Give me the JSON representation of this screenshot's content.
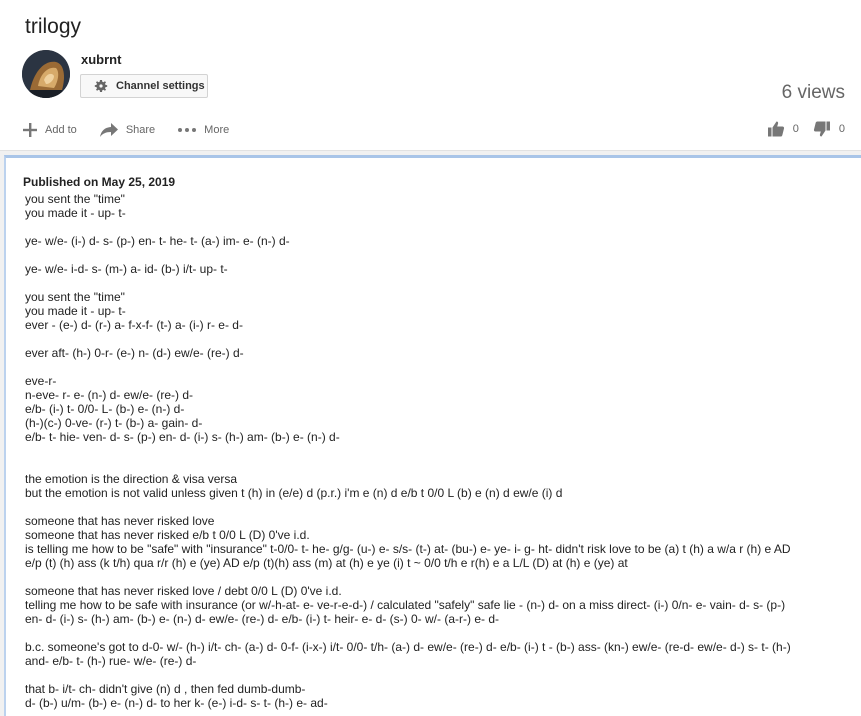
{
  "video": {
    "title": "trilogy",
    "views": "6 views",
    "likes": "0",
    "dislikes": "0"
  },
  "channel": {
    "name": "xubrnt",
    "settings_label": "Channel settings"
  },
  "actions": {
    "add_to": "Add to",
    "share": "Share",
    "more": "More"
  },
  "icons": {
    "add": "plus-icon",
    "share": "share-arrow-icon",
    "more": "more-dots-icon",
    "like": "thumbs-up-icon",
    "dislike": "thumbs-down-icon",
    "settings": "gear-icon"
  },
  "colors": {
    "accent_border": "#a9c5e8",
    "text": "#222222",
    "muted": "#666666"
  },
  "description": {
    "published": "Published on May 25, 2019",
    "body": "you sent the \"time\"\nyou made it - up- t-\n\nye- w/e- (i-) d- s- (p-) en- t- he- t- (a-) im- e- (n-) d-\n\nye- w/e- i-d- s- (m-) a- id- (b-) i/t- up- t-\n\nyou sent the \"time\"\nyou made it - up- t-\never - (e-) d- (r-) a- f-x-f- (t-) a- (i-) r- e- d-\n\never aft- (h-) 0-r- (e-) n- (d-) ew/e- (re-) d-\n\neve-r-\nn-eve- r- e- (n-) d- ew/e- (re-) d-\ne/b- (i-) t- 0/0- L- (b-) e- (n-) d-\n(h-)(c-) 0-ve- (r-) t- (b-) a- gain- d-\ne/b- t- hie- ven- d- s- (p-) en- d- (i-) s- (h-) am- (b-) e- (n-) d-\n\n\nthe emotion is the direction & visa versa\nbut the emotion is not valid unless given t (h) in (e/e) d (p.r.) i'm e (n) d e/b t 0/0 L (b) e (n) d ew/e (i) d\n\nsomeone that has never risked love\nsomeone that has never risked e/b t 0/0 L (D) 0've i.d.\nis telling me how to be \"safe\" with \"insurance\" t-0/0- t- he- g/g- (u-) e- s/s- (t-) at- (bu-) e- ye- i- g- ht- didn't risk love to be (a) t (h) a w/a r (h) e AD\ne/p (t) (h) ass (k t/h) qua r/r (h) e (ye) AD e/p (t)(h) ass (m) at (h) e ye (i) t ~ 0/0 t/h e r(h) e a L/L (D) at (h) e (ye) at\n\nsomeone that has never risked love / debt 0/0 L (D) 0've i.d.\ntelling me how to be safe with insurance (or w/-h-at- e- ve-r-e-d-) / calculated \"safely\" safe lie - (n-) d- on a miss direct- (i-) 0/n- e- vain- d- s- (p-)\nen- d- (i-) s- (h-) am- (b-) e- (n-) d- ew/e- (re-) d- e/b- (i-) t- heir- e- d- (s-) 0- w/- (a-r-) e- d-\n\nb.c. someone's got to d-0- w/- (h-) i/t- ch- (a-) d- 0-f- (i-x-) i/t- 0/0- t/h- (a-) d- ew/e- (re-) d- e/b- (i-) t - (b-) ass- (kn-) ew/e- (re-d- ew/e- d-) s- t- (h-)\nand- e/b- t- (h-) rue- w/e- (re-) d-\n\nthat b- i/t- ch- didn't give (n) d , then fed dumb-dumb-\nd- (b-) u/m- (b-) e- (n-) d- to her k- (e-) i-d- s- t- (h-) e- ad-"
  }
}
